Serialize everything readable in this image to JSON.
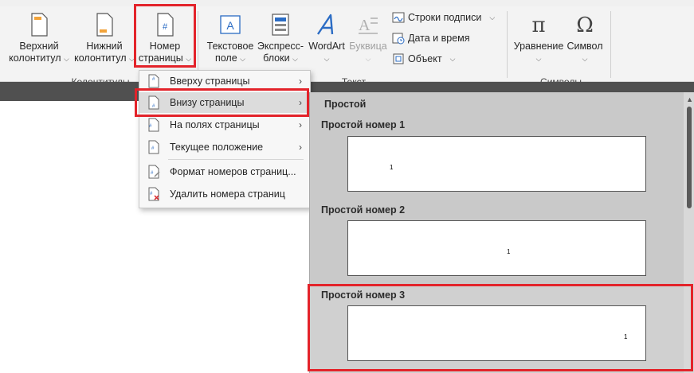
{
  "ribbon": {
    "header_footer_group": {
      "label": "Колонтитулы",
      "header": {
        "line1": "Верхний",
        "line2": "колонтитул",
        "icon": "header-icon"
      },
      "footer": {
        "line1": "Нижний",
        "line2": "колонтитул",
        "icon": "footer-icon"
      },
      "page_number": {
        "line1": "Номер",
        "line2": "страницы",
        "icon": "page-number-icon"
      }
    },
    "text_group": {
      "label": "Текст",
      "text_box": {
        "line1": "Текстовое",
        "line2": "поле",
        "icon": "text-box-icon"
      },
      "quick_parts": {
        "line1": "Экспресс-",
        "line2": "блоки",
        "icon": "quick-parts-icon"
      },
      "wordart": {
        "line1": "WordArt",
        "icon": "wordart-icon"
      },
      "dropcap": {
        "line1": "Буквица",
        "icon": "drop-cap-icon"
      },
      "signature_line": "Строки подписи",
      "date_time": "Дата и время",
      "object": "Объект"
    },
    "symbols_group": {
      "label": "Символы",
      "equation": {
        "line1": "Уравнение",
        "icon": "pi-icon",
        "glyph": "π"
      },
      "symbol": {
        "line1": "Символ",
        "icon": "omega-icon",
        "glyph": "Ω"
      }
    }
  },
  "page_number_menu": {
    "items": [
      {
        "label": "Вверху страницы",
        "has_submenu": true
      },
      {
        "label": "Внизу страницы",
        "has_submenu": true
      },
      {
        "label": "На полях страницы",
        "has_submenu": true
      },
      {
        "label": "Текущее положение",
        "has_submenu": true
      },
      {
        "label": "Формат номеров страниц...",
        "has_submenu": false
      },
      {
        "label": "Удалить номера страниц",
        "has_submenu": false
      }
    ]
  },
  "gallery": {
    "section_title": "Простой",
    "options": [
      {
        "title": "Простой номер 1",
        "number": "1",
        "align": "left"
      },
      {
        "title": "Простой номер 2",
        "number": "1",
        "align": "center"
      },
      {
        "title": "Простой номер 3",
        "number": "1",
        "align": "right"
      }
    ]
  },
  "colors": {
    "highlight_red": "#e3232a",
    "wordart_blue": "#2b6cc4"
  }
}
